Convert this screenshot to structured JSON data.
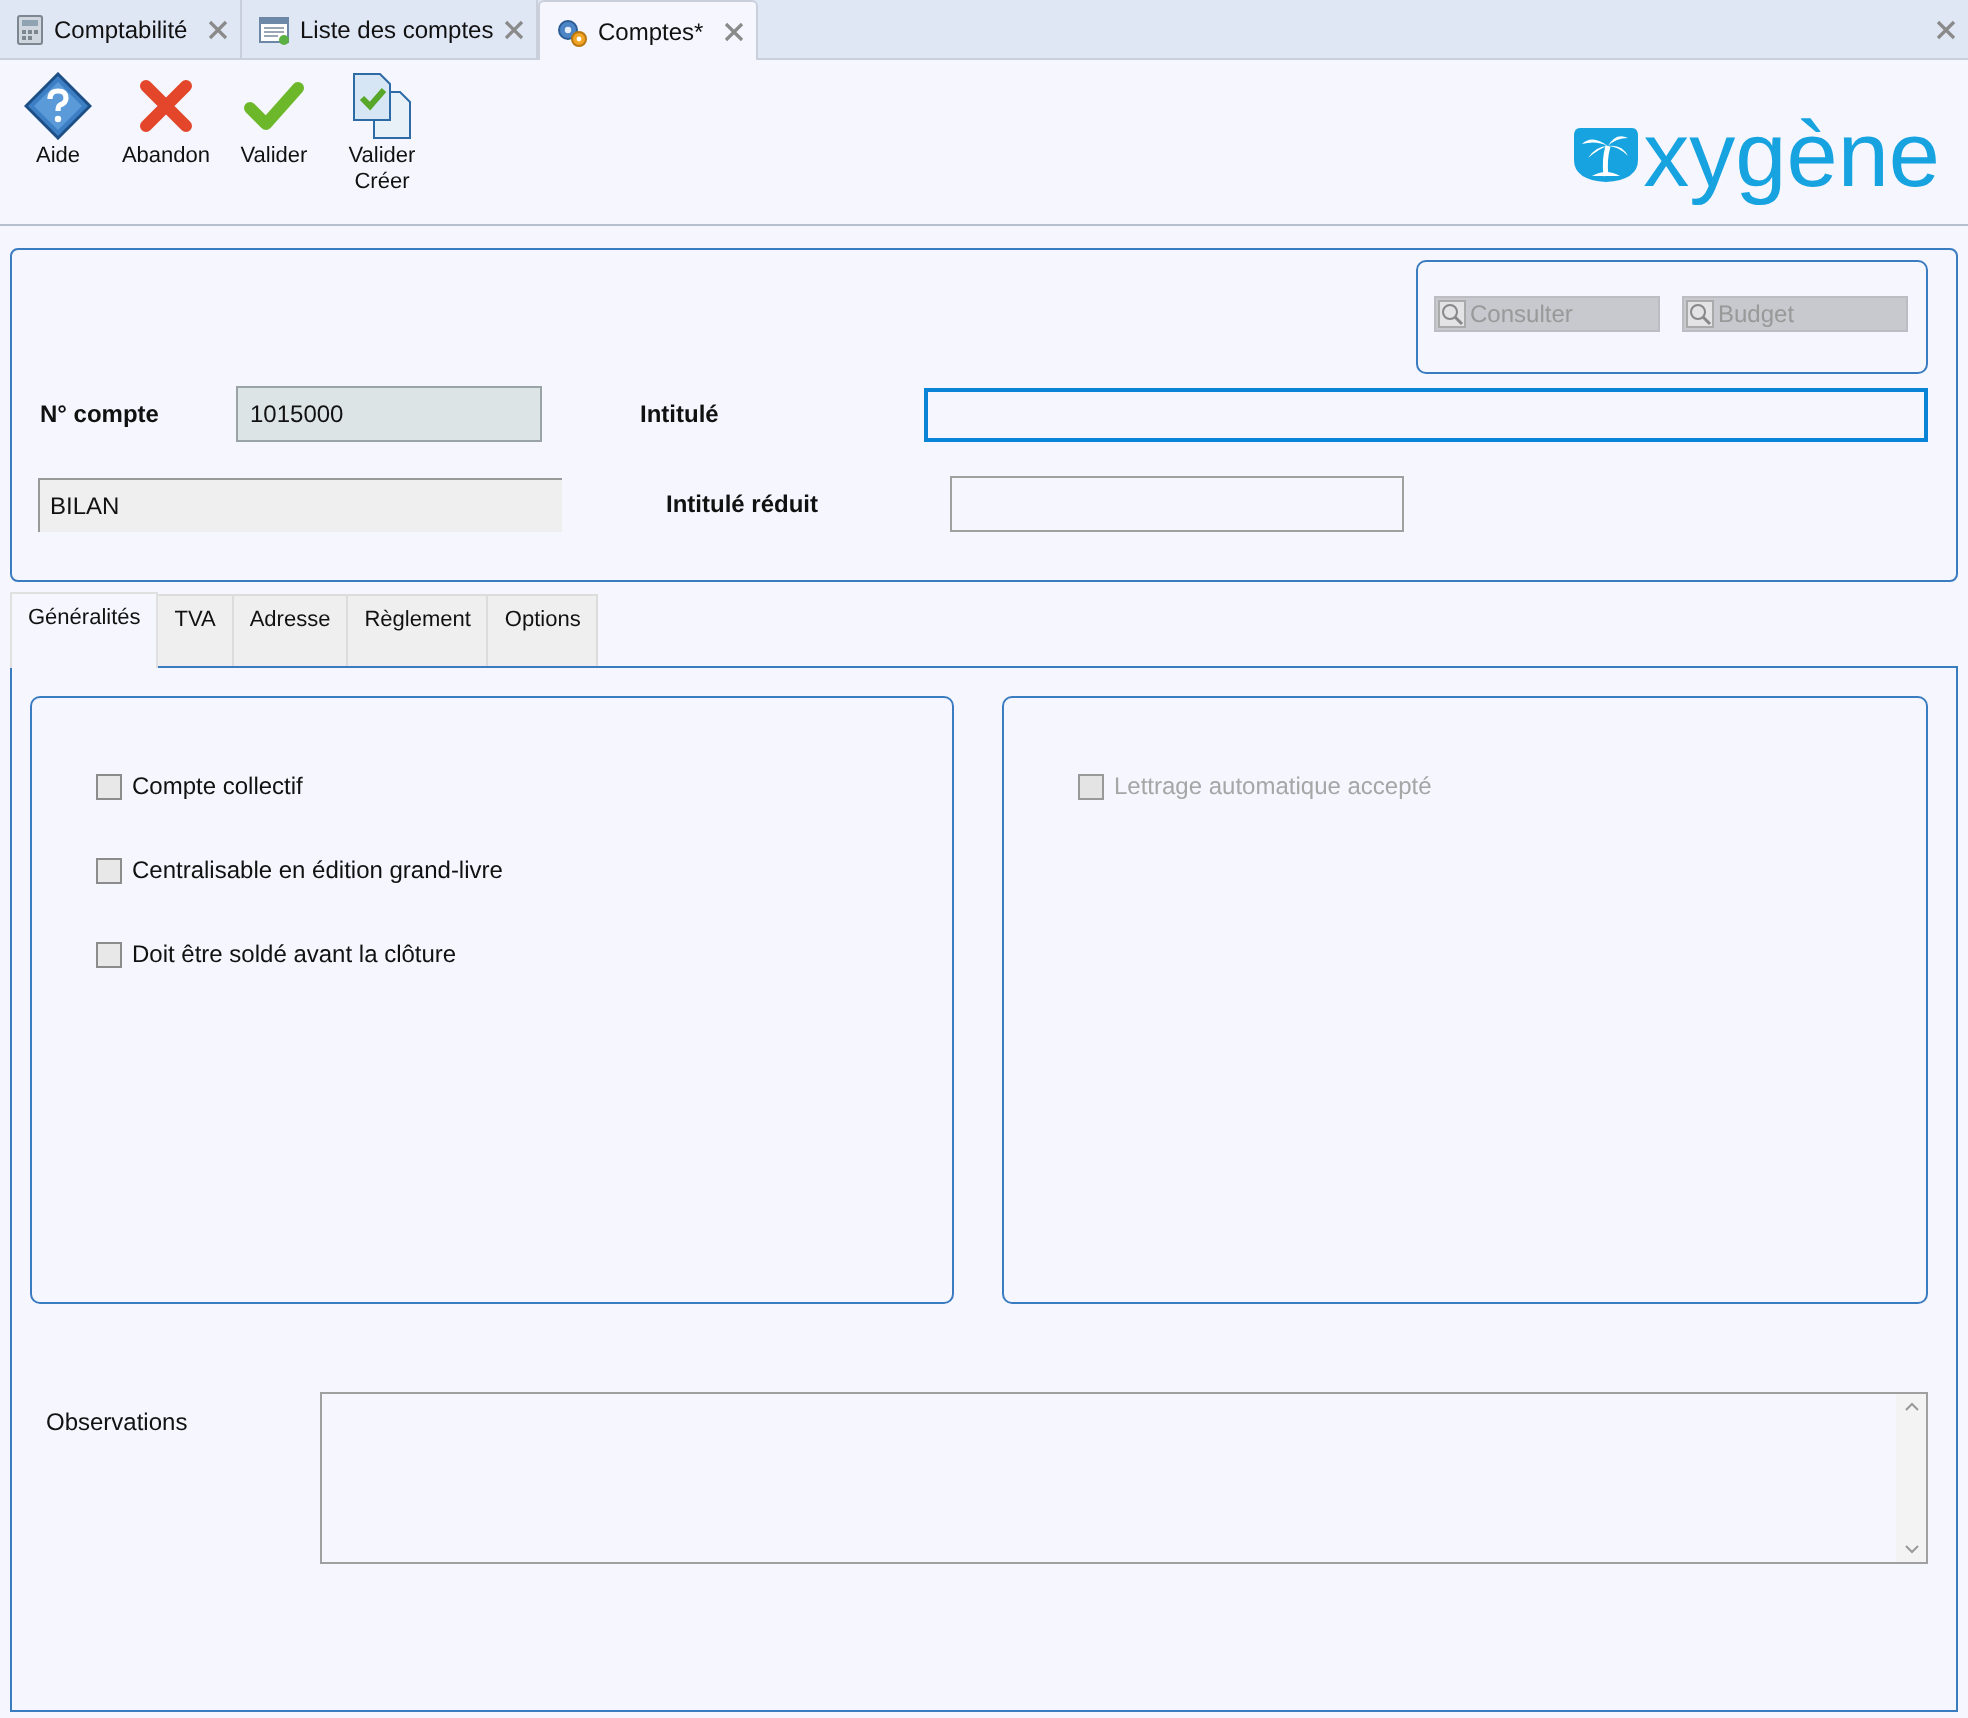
{
  "doc_tabs": [
    {
      "label": "Comptabilité",
      "kind": "calculator",
      "selected": false
    },
    {
      "label": "Liste des comptes",
      "kind": "list",
      "selected": false
    },
    {
      "label": "Comptes*",
      "kind": "gears",
      "selected": true
    }
  ],
  "toolbar": [
    {
      "label": "Aide",
      "kind": "help"
    },
    {
      "label": "Abandon",
      "kind": "cancel"
    },
    {
      "label": "Valider",
      "kind": "ok"
    },
    {
      "label": "Valider Créer",
      "kind": "okcreate"
    }
  ],
  "logo": {
    "text": "xygène"
  },
  "side_buttons": [
    {
      "label": "Consulter",
      "disabled": true
    },
    {
      "label": "Budget",
      "disabled": true
    }
  ],
  "header": {
    "account_label": "N° compte",
    "account_value": "1015000",
    "category_value": "BILAN",
    "title_label": "Intitulé",
    "short_title_label": "Intitulé réduit"
  },
  "form_tabs": [
    {
      "label": "Généralités",
      "selected": true
    },
    {
      "label": "TVA",
      "selected": false
    },
    {
      "label": "Adresse",
      "selected": false
    },
    {
      "label": "Règlement",
      "selected": false
    },
    {
      "label": "Options",
      "selected": false
    }
  ],
  "left_options": [
    {
      "label": "Compte collectif",
      "checked": false,
      "disabled": false
    },
    {
      "label": "Centralisable en édition grand-livre",
      "checked": false,
      "disabled": false
    },
    {
      "label": "Doit être soldé avant la clôture",
      "checked": false,
      "disabled": false
    }
  ],
  "right_options": [
    {
      "label": "Lettrage automatique accepté",
      "checked": false,
      "disabled": true
    }
  ],
  "observations": {
    "label": "Observations"
  }
}
